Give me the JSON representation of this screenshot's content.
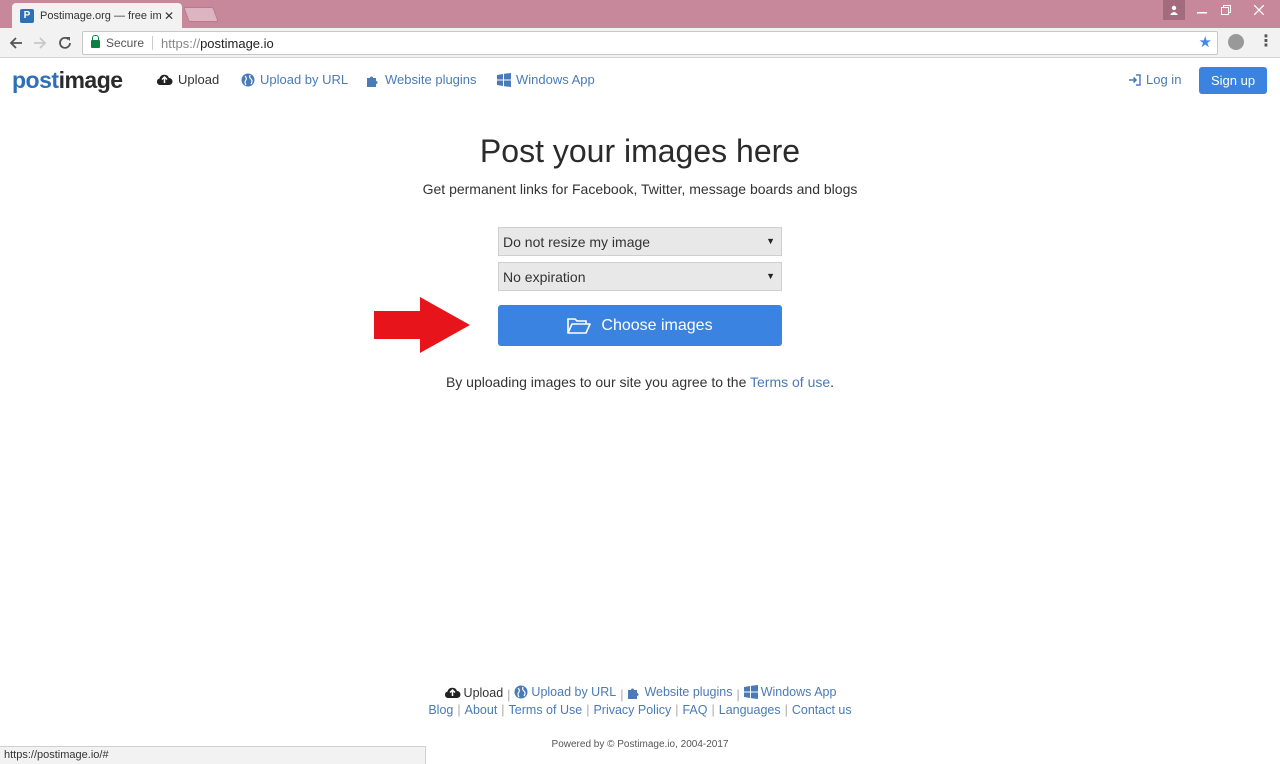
{
  "browser": {
    "tab_title": "Postimage.org — free im",
    "tab_favicon": "P",
    "close_glyph": "✕",
    "secure_label": "Secure",
    "url_scheme": "https://",
    "url_host": "postimage.io",
    "status_url": "https://postimage.io/#"
  },
  "nav": {
    "logo_part1": "post",
    "logo_part2": "image",
    "upload": "Upload",
    "upload_url": "Upload by URL",
    "plugins": "Website plugins",
    "windows_app": "Windows App",
    "login": "Log in",
    "signup": "Sign up"
  },
  "main": {
    "headline": "Post your images here",
    "subline": "Get permanent links for Facebook, Twitter, message boards and blogs",
    "resize_select": "Do not resize my image",
    "expiration_select": "No expiration",
    "choose_button": "Choose images",
    "terms_prefix": "By uploading images to our site you agree to the ",
    "terms_link": "Terms of use",
    "terms_suffix": "."
  },
  "footer": {
    "upload": "Upload",
    "upload_url": "Upload by URL",
    "plugins": "Website plugins",
    "windows_app": "Windows App",
    "blog": "Blog",
    "about": "About",
    "terms": "Terms of Use",
    "privacy": "Privacy Policy",
    "faq": "FAQ",
    "languages": "Languages",
    "contact": "Contact us",
    "powered": "Powered by © Postimage.io, 2004-2017",
    "sep": "|"
  },
  "colors": {
    "accent": "#3b83e0",
    "link": "#4a7ab8",
    "titlebar": "#c8889c",
    "arrow": "#e8141c"
  }
}
